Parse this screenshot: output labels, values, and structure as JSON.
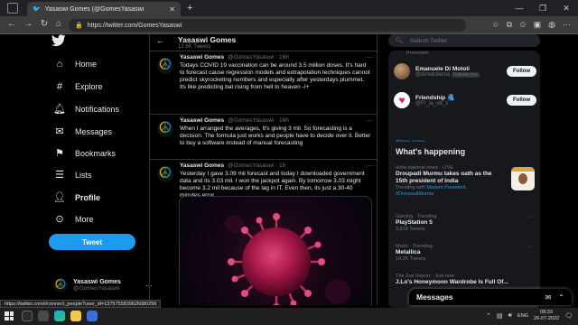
{
  "browser": {
    "tab_title": "Yasaswi Gomes (@GomesYasaswi",
    "tab_close": "✕",
    "new_tab": "+",
    "url": "https://twitter.com/GomesYasaswi",
    "window_controls": [
      "—",
      "❐",
      "✕"
    ]
  },
  "sidebar": {
    "items": [
      {
        "label": "Home",
        "icon": "home-icon"
      },
      {
        "label": "Explore",
        "icon": "hashtag-icon"
      },
      {
        "label": "Notifications",
        "icon": "bell-icon"
      },
      {
        "label": "Messages",
        "icon": "envelope-icon"
      },
      {
        "label": "Bookmarks",
        "icon": "bookmark-icon"
      },
      {
        "label": "Lists",
        "icon": "list-icon"
      },
      {
        "label": "Profile",
        "icon": "person-icon"
      },
      {
        "label": "More",
        "icon": "more-circle-icon"
      }
    ],
    "tweet_button": "Tweet",
    "account": {
      "name": "Yasaswi Gomes",
      "handle": "@GomesYasaswi",
      "more": "···"
    }
  },
  "main": {
    "title": "Yasaswi Gomes",
    "subtitle": "12.6K Tweets",
    "tweets": [
      {
        "name": "Yasaswi Gomes",
        "meta": "@GomesYasaswi · 16h",
        "text": "Todays COVID 19 vaccination can be around 3.5 million doses. It's hard to forecast cause regression models and extrapolation techniques cannot predict skyrocketing numbers and especially after yesterdays plummet. Its like predicting bat rising from hell to heaven -/+"
      },
      {
        "name": "Yasaswi Gomes",
        "meta": "@GomesYasaswi · 16h",
        "text": "When I arranged the averages, It's giving 3 mil. So forecasting is a decision. The formula just works and people have to decide over it. Better to buy a software instead of manual forecasting"
      },
      {
        "name": "Yasaswi Gomes",
        "meta": "@GomesYasaswi · 1h",
        "text": "Yesterday I gave 3.09 mil forecast and today I downloaded government data and its 3.03 mil. I won the jackpot again. By tomorrow 3.03 might become 3.2 mil because of the lag in IT. Even then, its just a 30-40 minutes error."
      }
    ]
  },
  "right": {
    "search_placeholder": "Search Twitter",
    "promoted": "Promoted",
    "who_to_follow": [
      {
        "name": "Emanuele Di Motoli",
        "handle": "@dimotollema",
        "badge": "Follows you",
        "button": "Follow"
      },
      {
        "name": "Friendship 🫂",
        "handle": "@Fr_ia_nd_s",
        "button": "Follow"
      }
    ],
    "show_more": "Show more",
    "happening_title": "What's happening",
    "trends": [
      {
        "meta": "India national news · LIVE",
        "title": "Droupadi Murmu takes oath as the 15th president of India",
        "sub_prefix": "Trending with ",
        "sub_links": "Madam President, #DroupadiMurmu"
      },
      {
        "meta": "Gaming · Trending",
        "title": "PlayStation 5",
        "sub": "3,818 Tweets"
      },
      {
        "meta": "Music · Trending",
        "title": "Metallica",
        "sub": "14.2K Tweets"
      },
      {
        "meta": "The Zoe Report · Just now",
        "title": "J.Lo's Honeymoon Wardrobe Is Full Of..."
      }
    ]
  },
  "messages": {
    "title": "Messages"
  },
  "status_link": "https://twitter.com/i/connect_people?user_id=1375755839626080256",
  "taskbar": {
    "lang": "ENG",
    "time": "08:33",
    "date": "26-07-2022"
  }
}
